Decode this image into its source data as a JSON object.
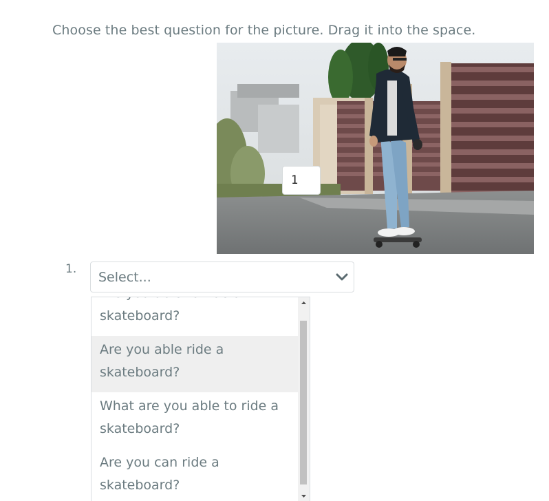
{
  "instruction": "Choose the best question for the picture. Drag it into the space.",
  "image": {
    "subject": "skateboarder-photo",
    "drop_box_value": "1"
  },
  "question": {
    "number": "1.",
    "select_value": "Select..."
  },
  "dropdown": {
    "options": [
      {
        "label": "Are you able to ride a skateboard?",
        "hovered": false
      },
      {
        "label": "Are you able ride a skateboard?",
        "hovered": true
      },
      {
        "label": "What are you able to ride a skateboard?",
        "hovered": false
      },
      {
        "label": "Are you can ride a skateboard?",
        "hovered": false
      }
    ]
  }
}
